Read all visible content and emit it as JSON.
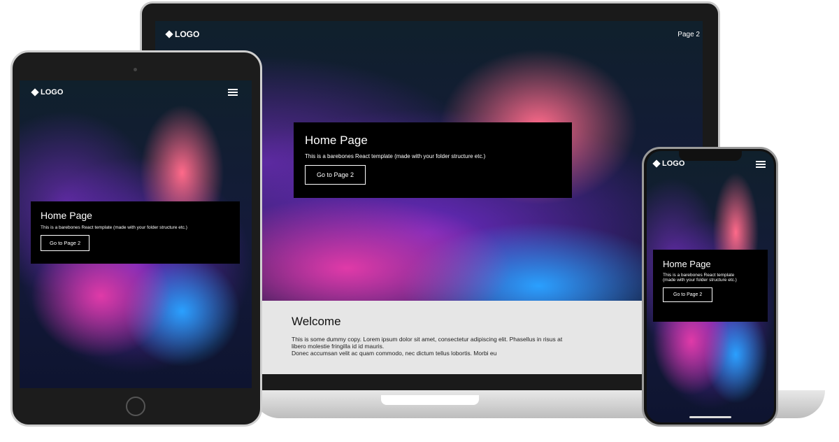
{
  "site": {
    "logo": "LOGO",
    "nav_link": "Page 2"
  },
  "hero": {
    "title": "Home Page",
    "text": "This is a barebones React template (made with your folder structure etc.)",
    "text_line1": "This is a barebones React template",
    "text_line2": "(made with your folder structure etc.)",
    "button": "Go to Page 2"
  },
  "welcome": {
    "title": "Welcome",
    "para1": "This is some dummy copy. Lorem ipsum dolor sit amet, consectetur adipiscing elit. Phasellus in risus at libero molestie fringilla id id mauris.",
    "para2": "Donec accumsan velit ac quam commodo, nec dictum tellus lobortis. Morbi eu"
  }
}
